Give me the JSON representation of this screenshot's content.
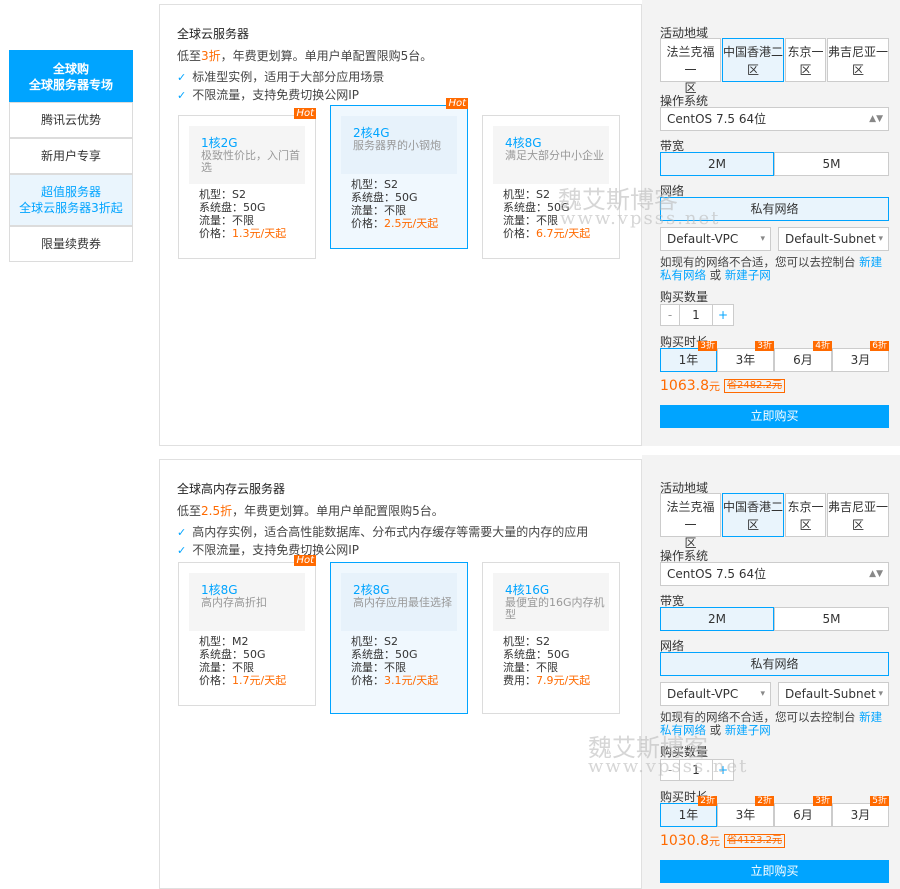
{
  "sidebar": {
    "items": [
      {
        "line1": "全球购",
        "line2": "全球服务器专场"
      },
      {
        "line1": "腾讯云优势",
        "line2": ""
      },
      {
        "line1": "新用户专享",
        "line2": ""
      },
      {
        "line1": "超值服务器",
        "line2": "全球云服务器3折起"
      },
      {
        "line1": "限量续费券",
        "line2": ""
      }
    ]
  },
  "sections": [
    {
      "title": "全球云服务器",
      "desc_pre": "低至",
      "desc_discount": "3折",
      "desc_post": "，年费更划算。单用户单配置限购5台。",
      "features": [
        "标准型实例，适用于大部分应用场景",
        "不限流量，支持免费切换公网IP"
      ],
      "cards": [
        {
          "hot": "Hot",
          "spec": "1核2G",
          "sub": "极致性价比，入门首选",
          "model": "机型：S2",
          "disk": "系统盘：50G",
          "traffic": "流量：不限",
          "price_label": "价格：",
          "price": "1.3元/天起"
        },
        {
          "hot": "Hot",
          "spec": "2核4G",
          "sub": "服务器界的小钢炮",
          "model": "机型：S2",
          "disk": "系统盘：50G",
          "traffic": "流量：不限",
          "price_label": "价格：",
          "price": "2.5元/天起"
        },
        {
          "hot": "",
          "spec": "4核8G",
          "sub": "满足大部分中小企业",
          "model": "机型：S2",
          "disk": "系统盘：50G",
          "traffic": "流量：不限",
          "price_label": "价格：",
          "price": "6.7元/天起"
        }
      ],
      "config": {
        "region_label": "活动地域",
        "regions": [
          [
            "法兰克福一",
            "区"
          ],
          [
            "中国香港二",
            "区"
          ],
          [
            "东京一",
            "区"
          ],
          [
            "弗吉尼亚一",
            "区"
          ]
        ],
        "os_label": "操作系统",
        "os_value": "CentOS 7.5 64位",
        "bw_label": "带宽",
        "bw_options": [
          "2M",
          "5M"
        ],
        "net_label": "网络",
        "net_value": "私有网络",
        "vpc": "Default-VPC",
        "subnet": "Default-Subnet",
        "hint_pre": "如现有的网络不合适，您可以去控制台 ",
        "hint_link1": "新建私有网络",
        "hint_mid": " 或 ",
        "hint_link2": "新建子网",
        "qty_label": "购买数量",
        "qty_minus": "-",
        "qty_value": "1",
        "qty_plus": "+",
        "dur_label": "购买时长",
        "durations": [
          {
            "label": "1年",
            "tag": "3折"
          },
          {
            "label": "3年",
            "tag": "3折"
          },
          {
            "label": "6月",
            "tag": "4折"
          },
          {
            "label": "3月",
            "tag": "6折"
          }
        ],
        "price": "1063.8",
        "price_unit": "元",
        "old_price": "省2482.2元",
        "buy": "立即购买"
      }
    },
    {
      "title": "全球高内存云服务器",
      "desc_pre": "低至",
      "desc_discount": "2.5折",
      "desc_post": "，年费更划算。单用户单配置限购5台。",
      "features": [
        "高内存实例，适合高性能数据库、分布式内存缓存等需要大量的内存的应用",
        "不限流量，支持免费切换公网IP"
      ],
      "cards": [
        {
          "hot": "Hot",
          "spec": "1核8G",
          "sub": "高内存高折扣",
          "model": "机型：M2",
          "disk": "系统盘：50G",
          "traffic": "流量：不限",
          "price_label": "价格：",
          "price": "1.7元/天起"
        },
        {
          "hot": "",
          "spec": "2核8G",
          "sub": "高内存应用最佳选择",
          "model": "机型：S2",
          "disk": "系统盘：50G",
          "traffic": "流量：不限",
          "price_label": "价格：",
          "price": "3.1元/天起"
        },
        {
          "hot": "",
          "spec": "4核16G",
          "sub": "最便宜的16G内存机型",
          "model": "机型：S2",
          "disk": "系统盘：50G",
          "traffic": "流量：不限",
          "price_label": "费用：",
          "price": "7.9元/天起"
        }
      ],
      "config": {
        "region_label": "活动地域",
        "regions": [
          [
            "法兰克福一",
            "区"
          ],
          [
            "中国香港二",
            "区"
          ],
          [
            "东京一",
            "区"
          ],
          [
            "弗吉尼亚一",
            "区"
          ]
        ],
        "os_label": "操作系统",
        "os_value": "CentOS 7.5 64位",
        "bw_label": "带宽",
        "bw_options": [
          "2M",
          "5M"
        ],
        "net_label": "网络",
        "net_value": "私有网络",
        "vpc": "Default-VPC",
        "subnet": "Default-Subnet",
        "hint_pre": "如现有的网络不合适，您可以去控制台 ",
        "hint_link1": "新建私有网络",
        "hint_mid": " 或 ",
        "hint_link2": "新建子网",
        "qty_label": "购买数量",
        "qty_minus": "-",
        "qty_value": "1",
        "qty_plus": "+",
        "dur_label": "购买时长",
        "durations": [
          {
            "label": "1年",
            "tag": "2折"
          },
          {
            "label": "3年",
            "tag": "2折"
          },
          {
            "label": "6月",
            "tag": "3折"
          },
          {
            "label": "3月",
            "tag": "5折"
          }
        ],
        "price": "1030.8",
        "price_unit": "元",
        "old_price": "省4123.2元",
        "buy": "立即购买"
      }
    }
  ],
  "watermark": {
    "cn": "魏艾斯博客",
    "url": "www.vpsss.net"
  }
}
